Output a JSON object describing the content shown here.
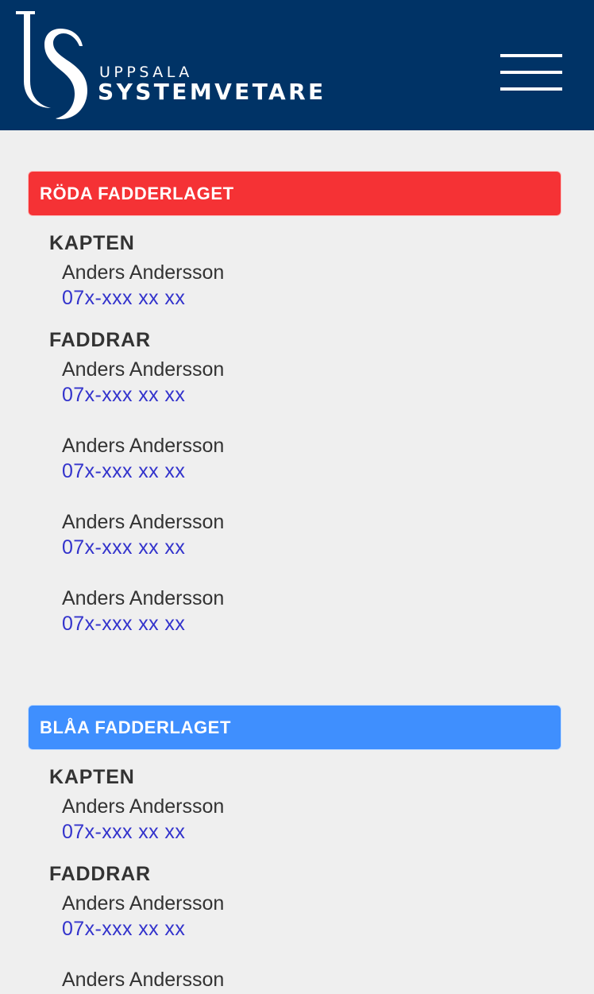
{
  "header": {
    "logo_small": "UPPSALA",
    "logo_big": "SYSTEMVETARE",
    "menu_icon": "hamburger-menu-icon",
    "background_color": "#003366"
  },
  "teams": [
    {
      "title": "RÖDA FADDERLAGET",
      "color": "#f53235",
      "captain_label": "KAPTEN",
      "captain": {
        "name": "Anders Andersson",
        "phone": "07x-xxx xx xx"
      },
      "sponsors_label": "FADDRAR",
      "sponsors": [
        {
          "name": "Anders Andersson",
          "phone": "07x-xxx xx xx"
        },
        {
          "name": "Anders Andersson",
          "phone": "07x-xxx xx xx"
        },
        {
          "name": "Anders Andersson",
          "phone": "07x-xxx xx xx"
        },
        {
          "name": "Anders Andersson",
          "phone": "07x-xxx xx xx"
        }
      ]
    },
    {
      "title": "BLÅA FADDERLAGET",
      "color": "#3f8ffe",
      "captain_label": "KAPTEN",
      "captain": {
        "name": "Anders Andersson",
        "phone": "07x-xxx xx xx"
      },
      "sponsors_label": "FADDRAR",
      "sponsors": [
        {
          "name": "Anders Andersson",
          "phone": "07x-xxx xx xx"
        },
        {
          "name": "Anders Andersson"
        }
      ]
    }
  ],
  "colors": {
    "link": "#3333cc",
    "text": "#333333",
    "page_background": "#efefef"
  }
}
